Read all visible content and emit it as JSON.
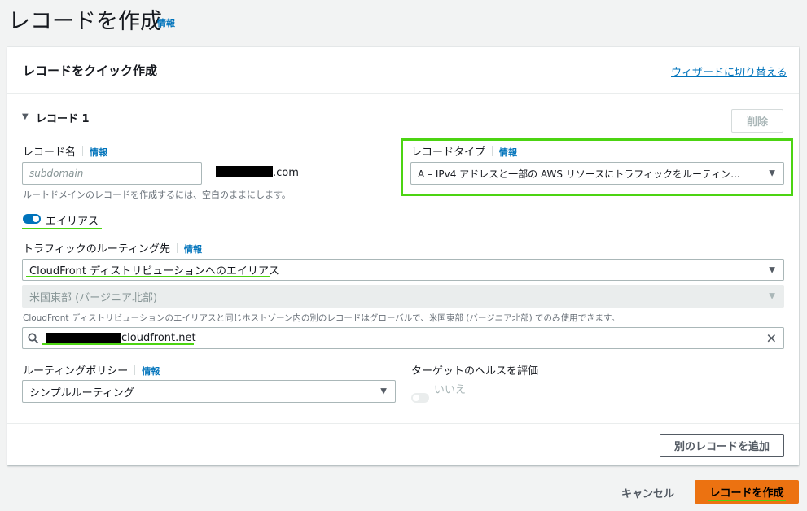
{
  "page": {
    "title": "レコードを作成",
    "info": "情報"
  },
  "panel": {
    "title": "レコードをクイック作成",
    "wizard_link": "ウィザードに切り替える"
  },
  "record": {
    "header": "レコード 1",
    "delete_button": "削除",
    "name": {
      "label": "レコード名",
      "info": "情報",
      "placeholder": "subdomain",
      "suffix": ".com",
      "description": "ルートドメインのレコードを作成するには、空白のままにします。"
    },
    "type": {
      "label": "レコードタイプ",
      "info": "情報",
      "value": "A – IPv4 アドレスと一部の AWS リソースにトラフィックをルーティン..."
    },
    "alias": {
      "label": "エイリアス",
      "enabled": true
    },
    "routing_target": {
      "label": "トラフィックのルーティング先",
      "info": "情報",
      "endpoint_value": "CloudFront ディストリビューションへのエイリアス",
      "region_value": "米国東部 (バージニア北部)",
      "description": "CloudFront ディストリビューションのエイリアスと同じホストゾーン内の別のレコードはグローバルで、米国東部 (バージニア北部) でのみ使用できます。",
      "search_value": "cloudfront.net"
    },
    "routing_policy": {
      "label": "ルーティングポリシー",
      "info": "情報",
      "value": "シンプルルーティング"
    },
    "health": {
      "label": "ターゲットのヘルスを評価",
      "toggle_label": "いいえ",
      "enabled": false
    }
  },
  "footer": {
    "add_record_button": "別のレコードを追加",
    "cancel_button": "キャンセル",
    "create_button": "レコードを作成"
  },
  "colors": {
    "accent_link": "#0073bb",
    "primary_button": "#ec7211",
    "highlight": "#4cd412",
    "toggle_on": "#0073bb"
  }
}
